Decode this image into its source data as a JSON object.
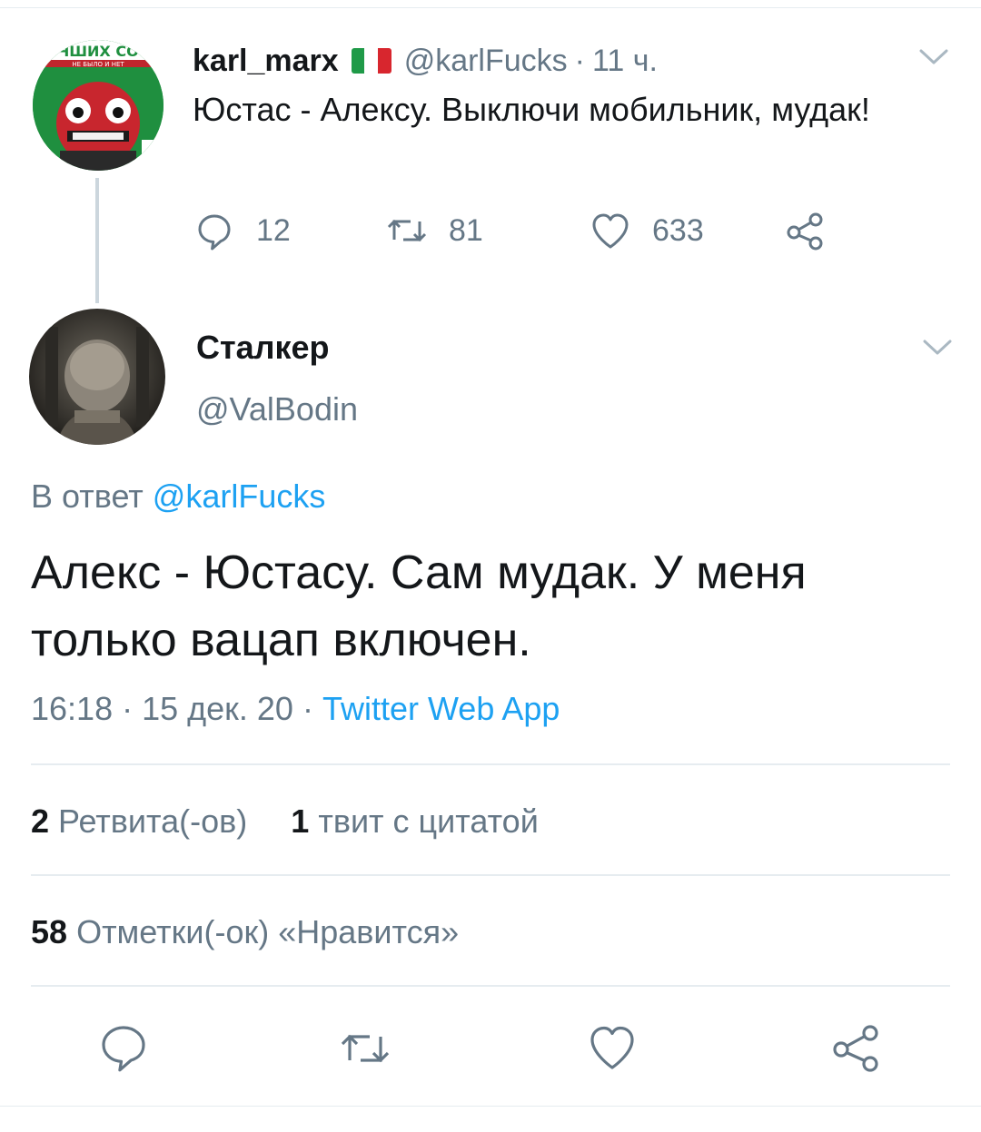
{
  "parent_tweet": {
    "display_name": "karl_marx",
    "flag": "italy-flag",
    "handle": "@karlFucks",
    "separator": "·",
    "time": "11 ч.",
    "text": "Юстас - Алексу.  Выключи мобильник, мудак!",
    "avatar_banner_top": "ЧШИХ СО",
    "avatar_banner_sub": "НЕ БЫЛО И НЕТ",
    "actions": {
      "replies": "12",
      "retweets": "81",
      "likes": "633"
    }
  },
  "reply_tweet": {
    "display_name": "Сталкер",
    "handle": "@ValBodin",
    "reply_prefix": "В ответ",
    "reply_mention": "@karlFucks",
    "text": "Алекс - Юстасу. Сам мудак. У меня только вацап включен.",
    "timestamp": "16:18 · 15 дек. 20 · ",
    "source": "Twitter Web App",
    "stats": {
      "retweet_count": "2",
      "retweet_label": "Ретвита(-ов)",
      "quote_count": "1",
      "quote_label": "твит с цитатой",
      "like_count": "58",
      "like_label": "Отметки(-ок) «Нравится»"
    }
  },
  "colors": {
    "text_primary": "#14171a",
    "text_secondary": "#657786",
    "link": "#1da1f2",
    "divider": "#e6ecf0",
    "icon": "#657786"
  },
  "icons": [
    "reply-icon",
    "retweet-icon",
    "like-icon",
    "share-icon",
    "chevron-down-icon"
  ]
}
